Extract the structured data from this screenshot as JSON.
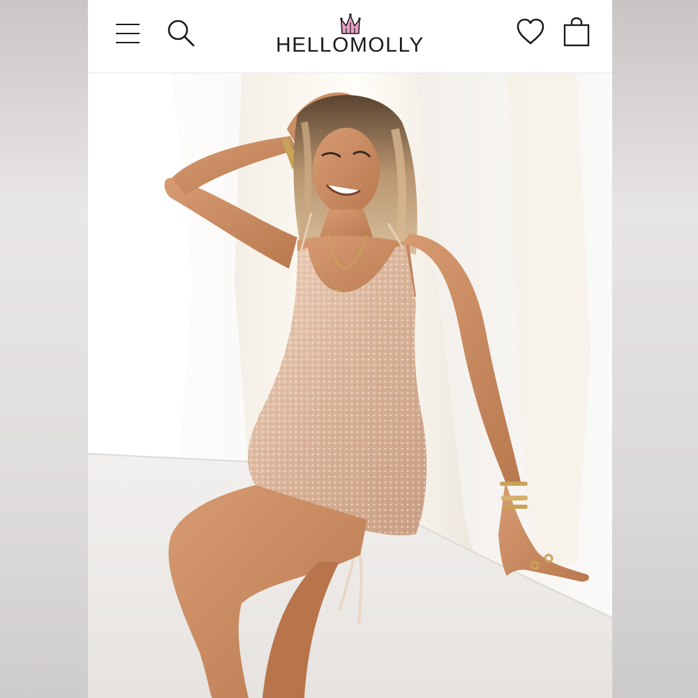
{
  "brand": {
    "name": "HELLOMOLLY",
    "logo_icon": "crown-icon",
    "crown_color": "#e8a1c6"
  },
  "header": {
    "menu_icon": "hamburger-menu-icon",
    "search_icon": "search-icon",
    "wishlist_icon": "heart-icon",
    "bag_icon": "shopping-bag-icon"
  },
  "product_image": {
    "dress_color": "#d9b49a",
    "background_color": "#fbf8f4"
  }
}
